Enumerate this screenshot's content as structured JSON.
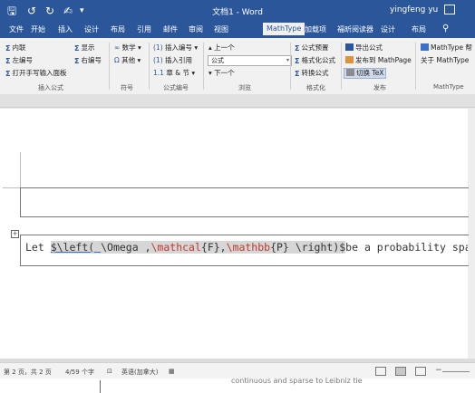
{
  "titlebar": {
    "title": "文档1 - Word",
    "user": "yingfeng yu",
    "save_icon": "save-icon",
    "undo_icon": "undo-icon",
    "redo_icon": "redo-icon",
    "touch_icon": "touch-mode-icon",
    "more_icon": "customize-icon",
    "color": "#2b579a"
  },
  "tabs": [
    {
      "label": "文件"
    },
    {
      "label": "开始"
    },
    {
      "label": "插入"
    },
    {
      "label": "设计"
    },
    {
      "label": "布局"
    },
    {
      "label": "引用"
    },
    {
      "label": "邮件"
    },
    {
      "label": "审阅"
    },
    {
      "label": "视图"
    },
    {
      "label": "MathType",
      "active": true
    },
    {
      "label": "加载项"
    },
    {
      "label": "福昕阅读器"
    },
    {
      "label": "设计"
    },
    {
      "label": "布局"
    }
  ],
  "ribbon": {
    "insert_formula": {
      "inline": "内联",
      "left_number": "左编号",
      "open_handwriting": "打开手写输入面板",
      "display": "显示",
      "right_number": "右编号",
      "label": "插入公式"
    },
    "symbols": {
      "math": "数学",
      "other": "其他",
      "label": "符号"
    },
    "equation_number": {
      "insert_number": "插入编号",
      "insert_reference": "插入引用",
      "chapter_section": "章 & 节",
      "label": "公式编号"
    },
    "browse": {
      "previous": "上一个",
      "dropdown_value": "公式",
      "next": "下一个",
      "label": "浏览"
    },
    "format": {
      "formula_preset": "公式预置",
      "format_formula": "格式化公式",
      "convert_formula": "转换公式",
      "label": "格式化"
    },
    "publish": {
      "export_formula": "导出公式",
      "publish_to_mathpage": "发布到 MathPage",
      "toggle_tex": "切换 TeX",
      "label": "发布"
    },
    "mathtype": {
      "mathtype_help": "MathType 帮",
      "about": "关于 MathType",
      "label": "MathType"
    }
  },
  "document": {
    "line_prefix": "Let ",
    "tex_open": "$\\left( ",
    "tex_omega": "\\Omega",
    "tex_comma1": " ,",
    "tex_mathcal": "\\mathcal",
    "tex_F": "{F}",
    "tex_comma2": ",",
    "tex_mathbb": "\\mathbb",
    "tex_P": "{P}",
    "tex_close": " \\right)$",
    "line_suffix": "be a probability space ··"
  },
  "statusbar": {
    "page": "第 2 页，共 2 页",
    "words": "4/59 个字",
    "language": "英语(加拿大)"
  },
  "below_page": {
    "text": "continuous and sparse to Leibniz tie"
  }
}
